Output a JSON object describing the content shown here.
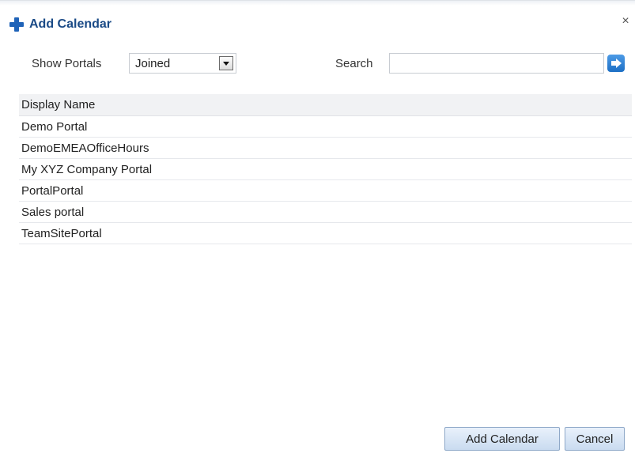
{
  "dialog": {
    "title": "Add Calendar",
    "close_label": "×"
  },
  "filters": {
    "show_portals_label": "Show Portals",
    "show_portals_value": "Joined",
    "search_label": "Search",
    "search_value": "",
    "search_placeholder": ""
  },
  "table": {
    "column_header": "Display Name",
    "rows": [
      "Demo Portal",
      "DemoEMEAOfficeHours",
      "My XYZ Company Portal",
      "PortalPortal",
      "Sales portal",
      "TeamSitePortal"
    ]
  },
  "buttons": {
    "add_label": "Add Calendar",
    "cancel_label": "Cancel"
  },
  "icons": {
    "title_icon": "plus-icon",
    "go_icon": "arrow-right-icon",
    "close_icon": "close-icon"
  },
  "colors": {
    "title_text": "#1a4a86",
    "accent": "#1f63b8"
  }
}
